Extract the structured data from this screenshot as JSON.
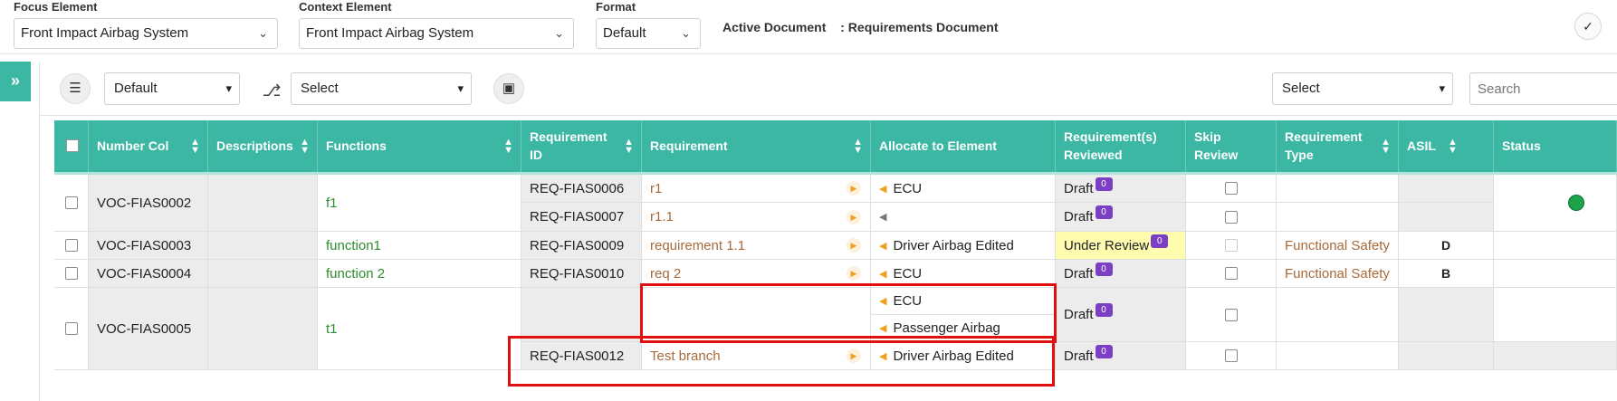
{
  "filters": {
    "focus_label": "Focus Element",
    "focus_value": "Front Impact Airbag System",
    "context_label": "Context Element",
    "context_value": "Front Impact Airbag System",
    "format_label": "Format",
    "format_value": "Default",
    "active_doc_label": "Active Document",
    "active_doc_value": ": Requirements Document"
  },
  "toolbar": {
    "layer_select": "Default",
    "hierarchy_select": "Select",
    "right_select": "Select",
    "search_placeholder": "Search"
  },
  "columns": [
    {
      "label": "Number Col"
    },
    {
      "label": "Descriptions"
    },
    {
      "label": "Functions"
    },
    {
      "label": "Requirement ID"
    },
    {
      "label": "Requirement"
    },
    {
      "label": "Allocate to Element"
    },
    {
      "label": "Requirement(s) Reviewed"
    },
    {
      "label": "Skip Review"
    },
    {
      "label": "Requirement Type"
    },
    {
      "label": "ASIL"
    },
    {
      "label": "Status"
    }
  ],
  "rows": {
    "r1": {
      "number": "VOC-FIAS0002",
      "function": "f1",
      "req_a": {
        "id": "REQ-FIAS0006",
        "name": "r1",
        "alloc": "ECU",
        "review": "Draft",
        "count": "0"
      },
      "req_b": {
        "id": "REQ-FIAS0007",
        "name": "r1.1",
        "alloc": "",
        "review": "Draft",
        "count": "0"
      }
    },
    "r2": {
      "number": "VOC-FIAS0003",
      "function": "function1",
      "id": "REQ-FIAS0009",
      "name": "requirement 1.1",
      "alloc": "Driver Airbag Edited",
      "review": "Under Review",
      "count": "0",
      "type": "Functional Safety",
      "asil": "D"
    },
    "r3": {
      "number": "VOC-FIAS0004",
      "function": "function 2",
      "id": "REQ-FIAS0010",
      "name": "req 2",
      "alloc": "ECU",
      "review": "Draft",
      "count": "0",
      "type": "Functional Safety",
      "asil": "B"
    },
    "r4": {
      "number": "VOC-FIAS0005",
      "function": "t1",
      "req_a": {
        "alloc1": "ECU",
        "alloc2": "Passenger Airbag",
        "review": "Draft",
        "count": "0"
      },
      "req_b": {
        "id": "REQ-FIAS0012",
        "name": "Test branch",
        "alloc": "Driver Airbag Edited",
        "review": "Draft",
        "count": "0"
      }
    }
  },
  "colors": {
    "header": "#3bb7a4",
    "highlight": "#e01010",
    "status": "#1ea34a",
    "badge": "#7b3fc4"
  }
}
